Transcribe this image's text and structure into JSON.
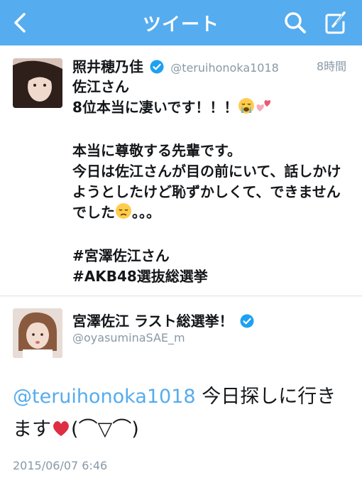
{
  "nav": {
    "title": "ツイート"
  },
  "tweet1": {
    "author_name": "照井穂乃佳",
    "handle": "@teruihonoka1018",
    "time": "8時間",
    "lines": [
      "佐江さん",
      "8位本当に凄いです！！！",
      "",
      "本当に尊敬する先輩です。",
      "今日は佐江さんが目の前にいて、話しかけ",
      "ようとしたけど恥ずかしくて、できません",
      "でした",
      "",
      "#宮澤佐江さん",
      "#AKB48選抜総選挙"
    ],
    "line7_suffix": "。。。"
  },
  "tweet2": {
    "author_name": "宮澤佐江 ラスト総選挙！",
    "handle": "@oyasuminaSAE_m",
    "mention": "@teruihonoka1018",
    "text_after_mention": " 今日探しに行き",
    "text_line2_a": "ます",
    "text_line2_b": "(⌒▽⌒)",
    "date": "2015/06/07 6:46"
  },
  "icons": [
    "back-arrow-icon",
    "search-icon",
    "compose-icon",
    "verified-badge-icon",
    "crying-emoji-icon",
    "two-hearts-emoji-icon",
    "disappointed-emoji-icon",
    "red-heart-emoji-icon"
  ],
  "colors": {
    "nav_bar": "#55acee",
    "mention": "#55acee",
    "verified": "#1da1f2"
  }
}
